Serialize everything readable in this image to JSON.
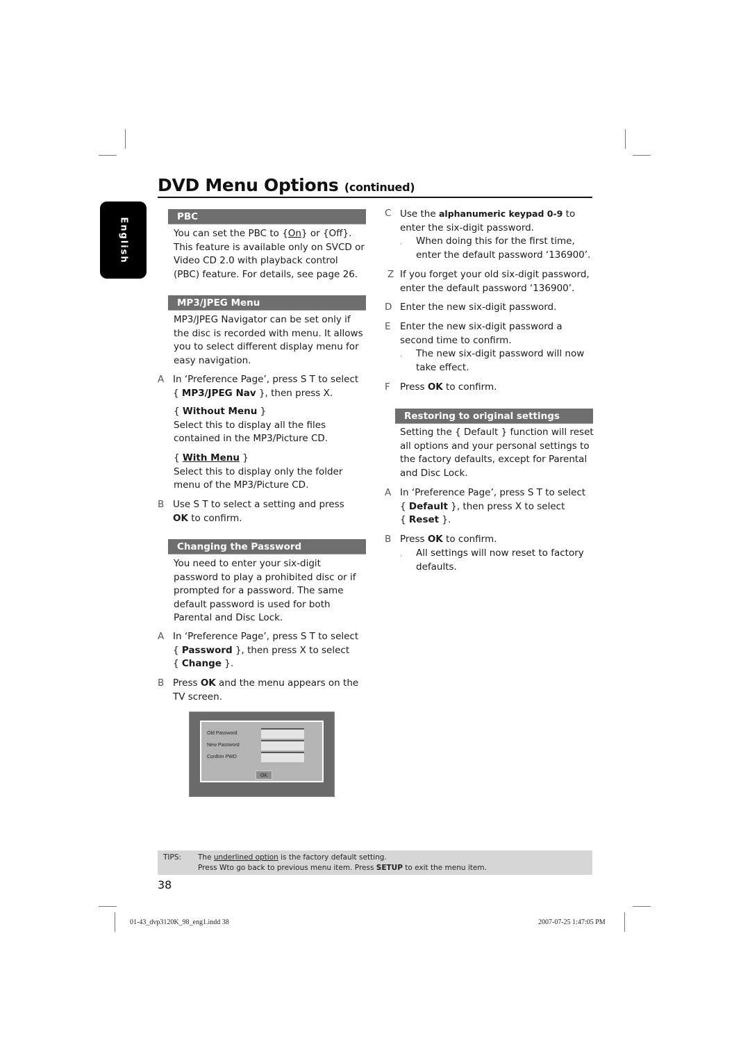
{
  "header": {
    "title": "DVD Menu Options",
    "title_suffix": "(continued)"
  },
  "language_tab": "English",
  "sections": {
    "pbc": {
      "heading": "PBC",
      "intro_pre": "You can set the PBC to {",
      "intro_on": "On",
      "intro_mid": "} or {Off}.",
      "intro_lines": [
        "This feature is available only on SVCD or",
        "Video CD 2.0 with playback control",
        "(PBC) feature. For details, see page 26."
      ]
    },
    "mp3": {
      "heading": "MP3/JPEG Menu",
      "intro_lines": [
        "MP3/JPEG Navigator can be set only if",
        "the disc is recorded with menu. It allows",
        "you to select different display menu for",
        "easy navigation."
      ],
      "step_a": {
        "letter": "A",
        "line1": "In ‘Preference Page’, press  S  T to select",
        "line2_pre": "{ ",
        "line2_bold": "MP3/JPEG Nav",
        "line2_post": " }, then press  X."
      },
      "option_without": {
        "label": "Without Menu",
        "desc_lines": [
          "Select this to display all the files",
          "contained in the MP3/Picture CD."
        ]
      },
      "option_with": {
        "label": "With Menu",
        "desc_lines": [
          "Select this to display only the folder",
          "menu of the MP3/Picture CD."
        ]
      },
      "step_b": {
        "letter": "B",
        "line1": "Use  S  T to select a setting and press",
        "line2_bold": "OK",
        "line2_post": " to confirm."
      }
    },
    "password": {
      "heading": "Changing the Password",
      "intro_lines": [
        "You need to enter your six-digit",
        "password to play a prohibited disc or if",
        "prompted for a password. The same",
        "default password is used for both",
        "Parental and Disc Lock."
      ],
      "step_a": {
        "letter": "A",
        "line1": "In ‘Preference Page’, press  S  T to select",
        "line2_bold": "Password",
        "line2_post": " }, then press  X to select",
        "line3_bold": "Change"
      },
      "step_b": {
        "letter": "B",
        "line1_pre": "Press ",
        "line1_bold": "OK",
        "line1_post": " and the menu appears on the",
        "line2": "TV screen."
      },
      "dialog": {
        "fields": [
          "Old Password",
          "New Password",
          "Confirm PWD"
        ],
        "ok_label": "OK"
      },
      "step_c": {
        "letter": "C",
        "line1_pre": "Use the ",
        "line1_bold": "alphanumeric keypad 0-9",
        "line1_post": " to",
        "line2": "enter the six-digit password.",
        "note_lines": [
          "When doing this for the first time,",
          "enter the default password ‘136900’."
        ]
      },
      "step_z": {
        "letter": "Z",
        "lines": [
          "If you forget your old six-digit password,",
          "enter the default password ‘136900’."
        ]
      },
      "step_d": {
        "letter": "D",
        "line1": "Enter the new six-digit password."
      },
      "step_e": {
        "letter": "E",
        "lines": [
          "Enter the new six-digit password a",
          "second time to confirm."
        ],
        "note_lines": [
          "The new six-digit password will now",
          "take effect."
        ]
      },
      "step_f": {
        "letter": "F",
        "pre": "Press ",
        "bold": "OK",
        "post": " to confirm."
      }
    },
    "restore": {
      "heading": "Restoring to original settings",
      "intro_lines": [
        "Setting the { Default } function will reset",
        "all options and your personal settings to",
        "the factory defaults, except for Parental",
        "and Disc Lock."
      ],
      "step_a": {
        "letter": "A",
        "line1": "In ‘Preference Page’, press  S  T to select",
        "line2_bold": "Default",
        "line2_post": " }, then press  X to select",
        "line3_bold": "Reset"
      },
      "step_b": {
        "letter": "B",
        "pre": "Press ",
        "bold": "OK",
        "post": " to confirm.",
        "note_lines": [
          "All settings will now reset to factory",
          "defaults."
        ]
      }
    }
  },
  "tips": {
    "label": "TIPS:",
    "line1_pre": "The ",
    "line1_underlined": "underlined option",
    "line1_post": " is the factory default setting.",
    "line2_pre": "Press   Wto go back to previous menu item. Press ",
    "line2_bold": "SETUP",
    "line2_post": " to exit the menu item."
  },
  "page_number": "38",
  "footer": {
    "file": "01-43_dvp3120K_98_eng1.indd   38",
    "timestamp": "2007-07-25   1:47:05 PM"
  }
}
